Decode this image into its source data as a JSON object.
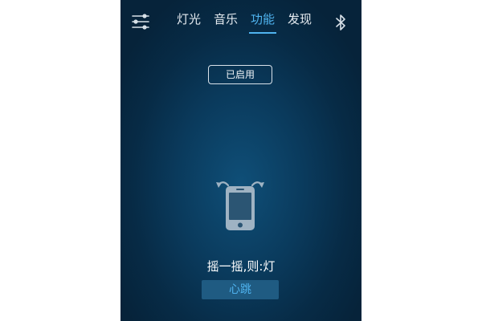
{
  "header": {
    "tabs": [
      {
        "label": "灯光",
        "active": false
      },
      {
        "label": "音乐",
        "active": false
      },
      {
        "label": "功能",
        "active": true
      },
      {
        "label": "发现",
        "active": false
      }
    ],
    "menu_icon": "sliders-menu-icon",
    "bluetooth_icon": "bluetooth-icon"
  },
  "main": {
    "status_button_label": "已启用",
    "feature_icon": "shake-phone-icon",
    "mode_text": "摇一摇,则:灯",
    "mode_button_label": "心跳"
  },
  "colors": {
    "background": "#0a3a5c",
    "accent": "#4fb3ef",
    "button_fill": "#1f5b82"
  }
}
